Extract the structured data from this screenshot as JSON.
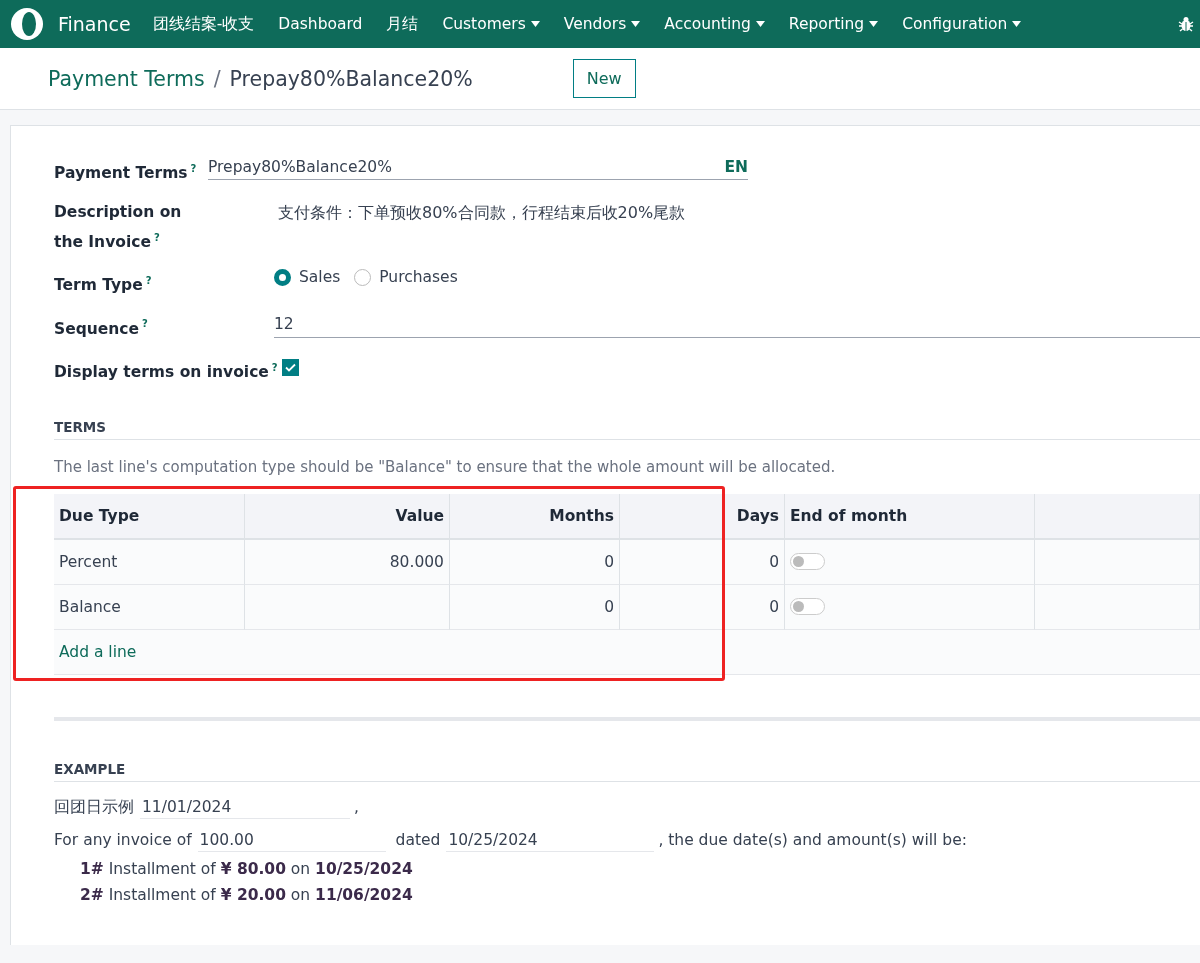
{
  "navbar": {
    "app_name": "Finance",
    "menus": [
      {
        "label": "团线结案-收支",
        "dropdown": false
      },
      {
        "label": "Dashboard",
        "dropdown": false
      },
      {
        "label": "月结",
        "dropdown": false
      },
      {
        "label": "Customers",
        "dropdown": true
      },
      {
        "label": "Vendors",
        "dropdown": true
      },
      {
        "label": "Accounting",
        "dropdown": true
      },
      {
        "label": "Reporting",
        "dropdown": true
      },
      {
        "label": "Configuration",
        "dropdown": true
      }
    ]
  },
  "breadcrumb": {
    "parent": "Payment Terms",
    "separator": "/",
    "current": "Prepay80%Balance20%"
  },
  "new_button": "New",
  "form": {
    "title_field": {
      "label": "Payment Terms",
      "help": "?",
      "value": "Prepay80%Balance20%",
      "lang": "EN"
    },
    "fields": [
      {
        "kind": "text",
        "label": "Description on the Invoice",
        "help": "?",
        "value": "支付条件：下单预收80%合同款，行程结束后收20%尾款"
      },
      {
        "kind": "radio",
        "label": "Term Type",
        "help": "?",
        "options": [
          {
            "label": "Sales",
            "selected": true
          },
          {
            "label": "Purchases",
            "selected": false
          }
        ]
      },
      {
        "kind": "input",
        "label": "Sequence",
        "help": "?",
        "value": "12"
      },
      {
        "kind": "checkbox",
        "label": "Display terms on invoice",
        "help": "?",
        "checked": true
      }
    ]
  },
  "terms": {
    "heading": "TERMS",
    "note": "The last line's computation type should be \"Balance\" to ensure that the whole amount will be allocated.",
    "columns": [
      "Due Type",
      "Value",
      "Months",
      "Days",
      "End of month"
    ],
    "rows": [
      {
        "due_type": "Percent",
        "value": "80.000",
        "months": "0",
        "days": "0",
        "end_of_month": false
      },
      {
        "due_type": "Balance",
        "months": "0",
        "days": "0",
        "end_of_month": false
      }
    ],
    "add_line": "Add a line",
    "highlighted": true
  },
  "example": {
    "heading": "EXAMPLE",
    "date_label": "回团日示例",
    "date_value": "11/01/2024",
    "separator": ",",
    "invoice_prefix": "For any invoice of",
    "amount": "100.00",
    "dated_label": "dated",
    "invoice_date": "10/25/2024",
    "suffix": ", the due date(s) and amount(s) will be:",
    "installments": [
      "**1#** Installment of **¥ 80.00** on **10/25/2024**",
      "**2#** Installment of **¥ 20.00** on **11/06/2024**"
    ]
  }
}
